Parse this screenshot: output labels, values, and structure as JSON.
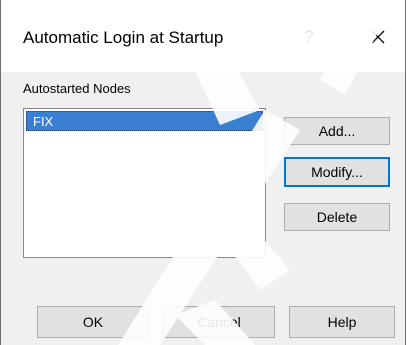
{
  "dialog": {
    "title": "Automatic Login at Startup",
    "help_glyph": "?",
    "close_icon": "close-icon"
  },
  "group": {
    "label": "Autostarted Nodes"
  },
  "list": {
    "items": [
      {
        "label": "FIX",
        "selected": true
      }
    ]
  },
  "side_buttons": {
    "add": "Add...",
    "modify": "Modify...",
    "delete": "Delete"
  },
  "footer_buttons": {
    "ok": "OK",
    "cancel": "Cancel",
    "help": "Help"
  },
  "colors": {
    "selection": "#3b7fd0",
    "button_face": "#e1e1e1",
    "dialog_bg": "#f0f0f0",
    "default_focus": "#0078d7"
  }
}
